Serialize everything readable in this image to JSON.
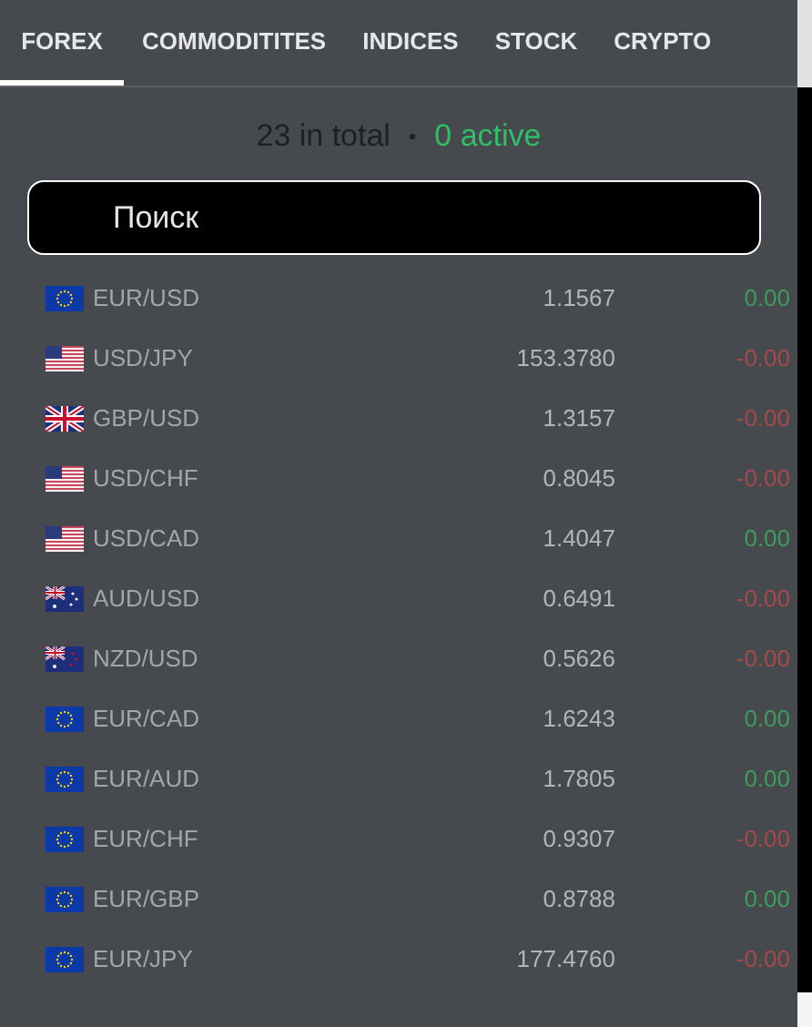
{
  "tabs": [
    {
      "label": "FOREX",
      "selected": true
    },
    {
      "label": "COMMODITITES",
      "selected": false
    },
    {
      "label": "INDICES",
      "selected": false
    },
    {
      "label": "STOCK",
      "selected": false
    },
    {
      "label": "CRYPTO",
      "selected": false
    }
  ],
  "summary": {
    "total": "23 in total",
    "separator": "•",
    "active": "0 active"
  },
  "search": {
    "placeholder": "Поиск"
  },
  "rows": [
    {
      "kind": "eu",
      "pair": "EUR/USD",
      "price": "1.1567",
      "change": "0.00",
      "color": "#3f9a5e"
    },
    {
      "kind": "us",
      "pair": "USD/JPY",
      "price": "153.3780",
      "change": "-0.00",
      "color": "#a34a4a"
    },
    {
      "kind": "uk",
      "pair": "GBP/USD",
      "price": "1.3157",
      "change": "-0.00",
      "color": "#a34a4a"
    },
    {
      "kind": "us",
      "pair": "USD/CHF",
      "price": "0.8045",
      "change": "-0.00",
      "color": "#a34a4a"
    },
    {
      "kind": "us",
      "pair": "USD/CAD",
      "price": "1.4047",
      "change": "0.00",
      "color": "#3f9a5e"
    },
    {
      "kind": "au",
      "pair": "AUD/USD",
      "price": "0.6491",
      "change": "-0.00",
      "color": "#a34a4a"
    },
    {
      "kind": "nz",
      "pair": "NZD/USD",
      "price": "0.5626",
      "change": "-0.00",
      "color": "#a34a4a"
    },
    {
      "kind": "eu",
      "pair": "EUR/CAD",
      "price": "1.6243",
      "change": "0.00",
      "color": "#3f9a5e"
    },
    {
      "kind": "eu",
      "pair": "EUR/AUD",
      "price": "1.7805",
      "change": "0.00",
      "color": "#3f9a5e"
    },
    {
      "kind": "eu",
      "pair": "EUR/CHF",
      "price": "0.9307",
      "change": "-0.00",
      "color": "#a34a4a"
    },
    {
      "kind": "eu",
      "pair": "EUR/GBP",
      "price": "0.8788",
      "change": "0.00",
      "color": "#3f9a5e"
    },
    {
      "kind": "eu",
      "pair": "EUR/JPY",
      "price": "177.4760",
      "change": "-0.00",
      "color": "#a34a4a"
    }
  ]
}
